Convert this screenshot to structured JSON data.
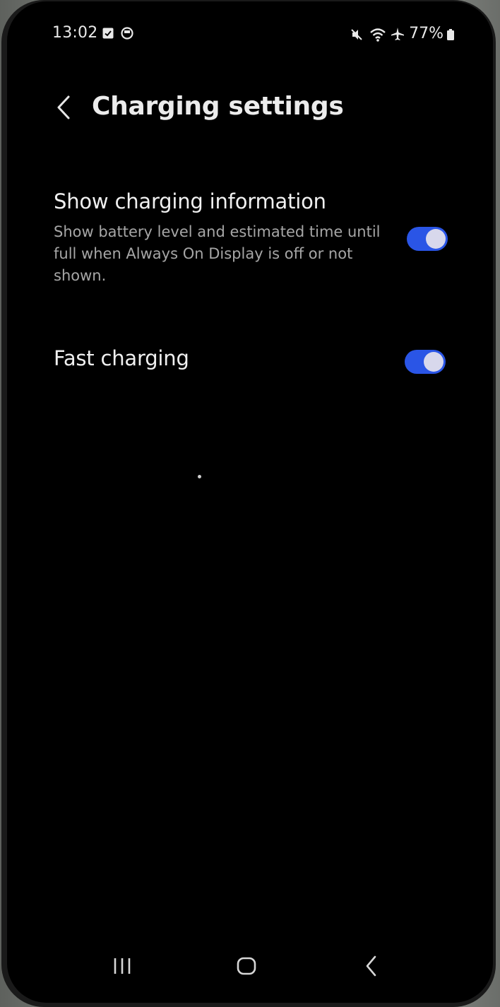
{
  "status_bar": {
    "time": "13:02",
    "left_icons": [
      "calendar-check-icon",
      "notification-circle-icon"
    ],
    "right_icons": [
      "mute-icon",
      "wifi-icon",
      "airplane-mode-icon"
    ],
    "battery_percent": "77%"
  },
  "header": {
    "back_icon": "chevron-left-icon",
    "title": "Charging settings"
  },
  "settings": [
    {
      "title": "Show charging information",
      "subtitle": "Show battery level and estimated time until full when Always On Display is off or not shown.",
      "enabled": true
    },
    {
      "title": "Fast charging",
      "enabled": true
    }
  ],
  "nav_bar": {
    "recents_icon": "recents-icon",
    "home_icon": "home-icon",
    "back_icon": "back-icon"
  },
  "colors": {
    "background": "#000000",
    "toggle_on": "#2a55e6",
    "text_primary": "#f0f0f0",
    "text_secondary": "#a6a6a6"
  }
}
